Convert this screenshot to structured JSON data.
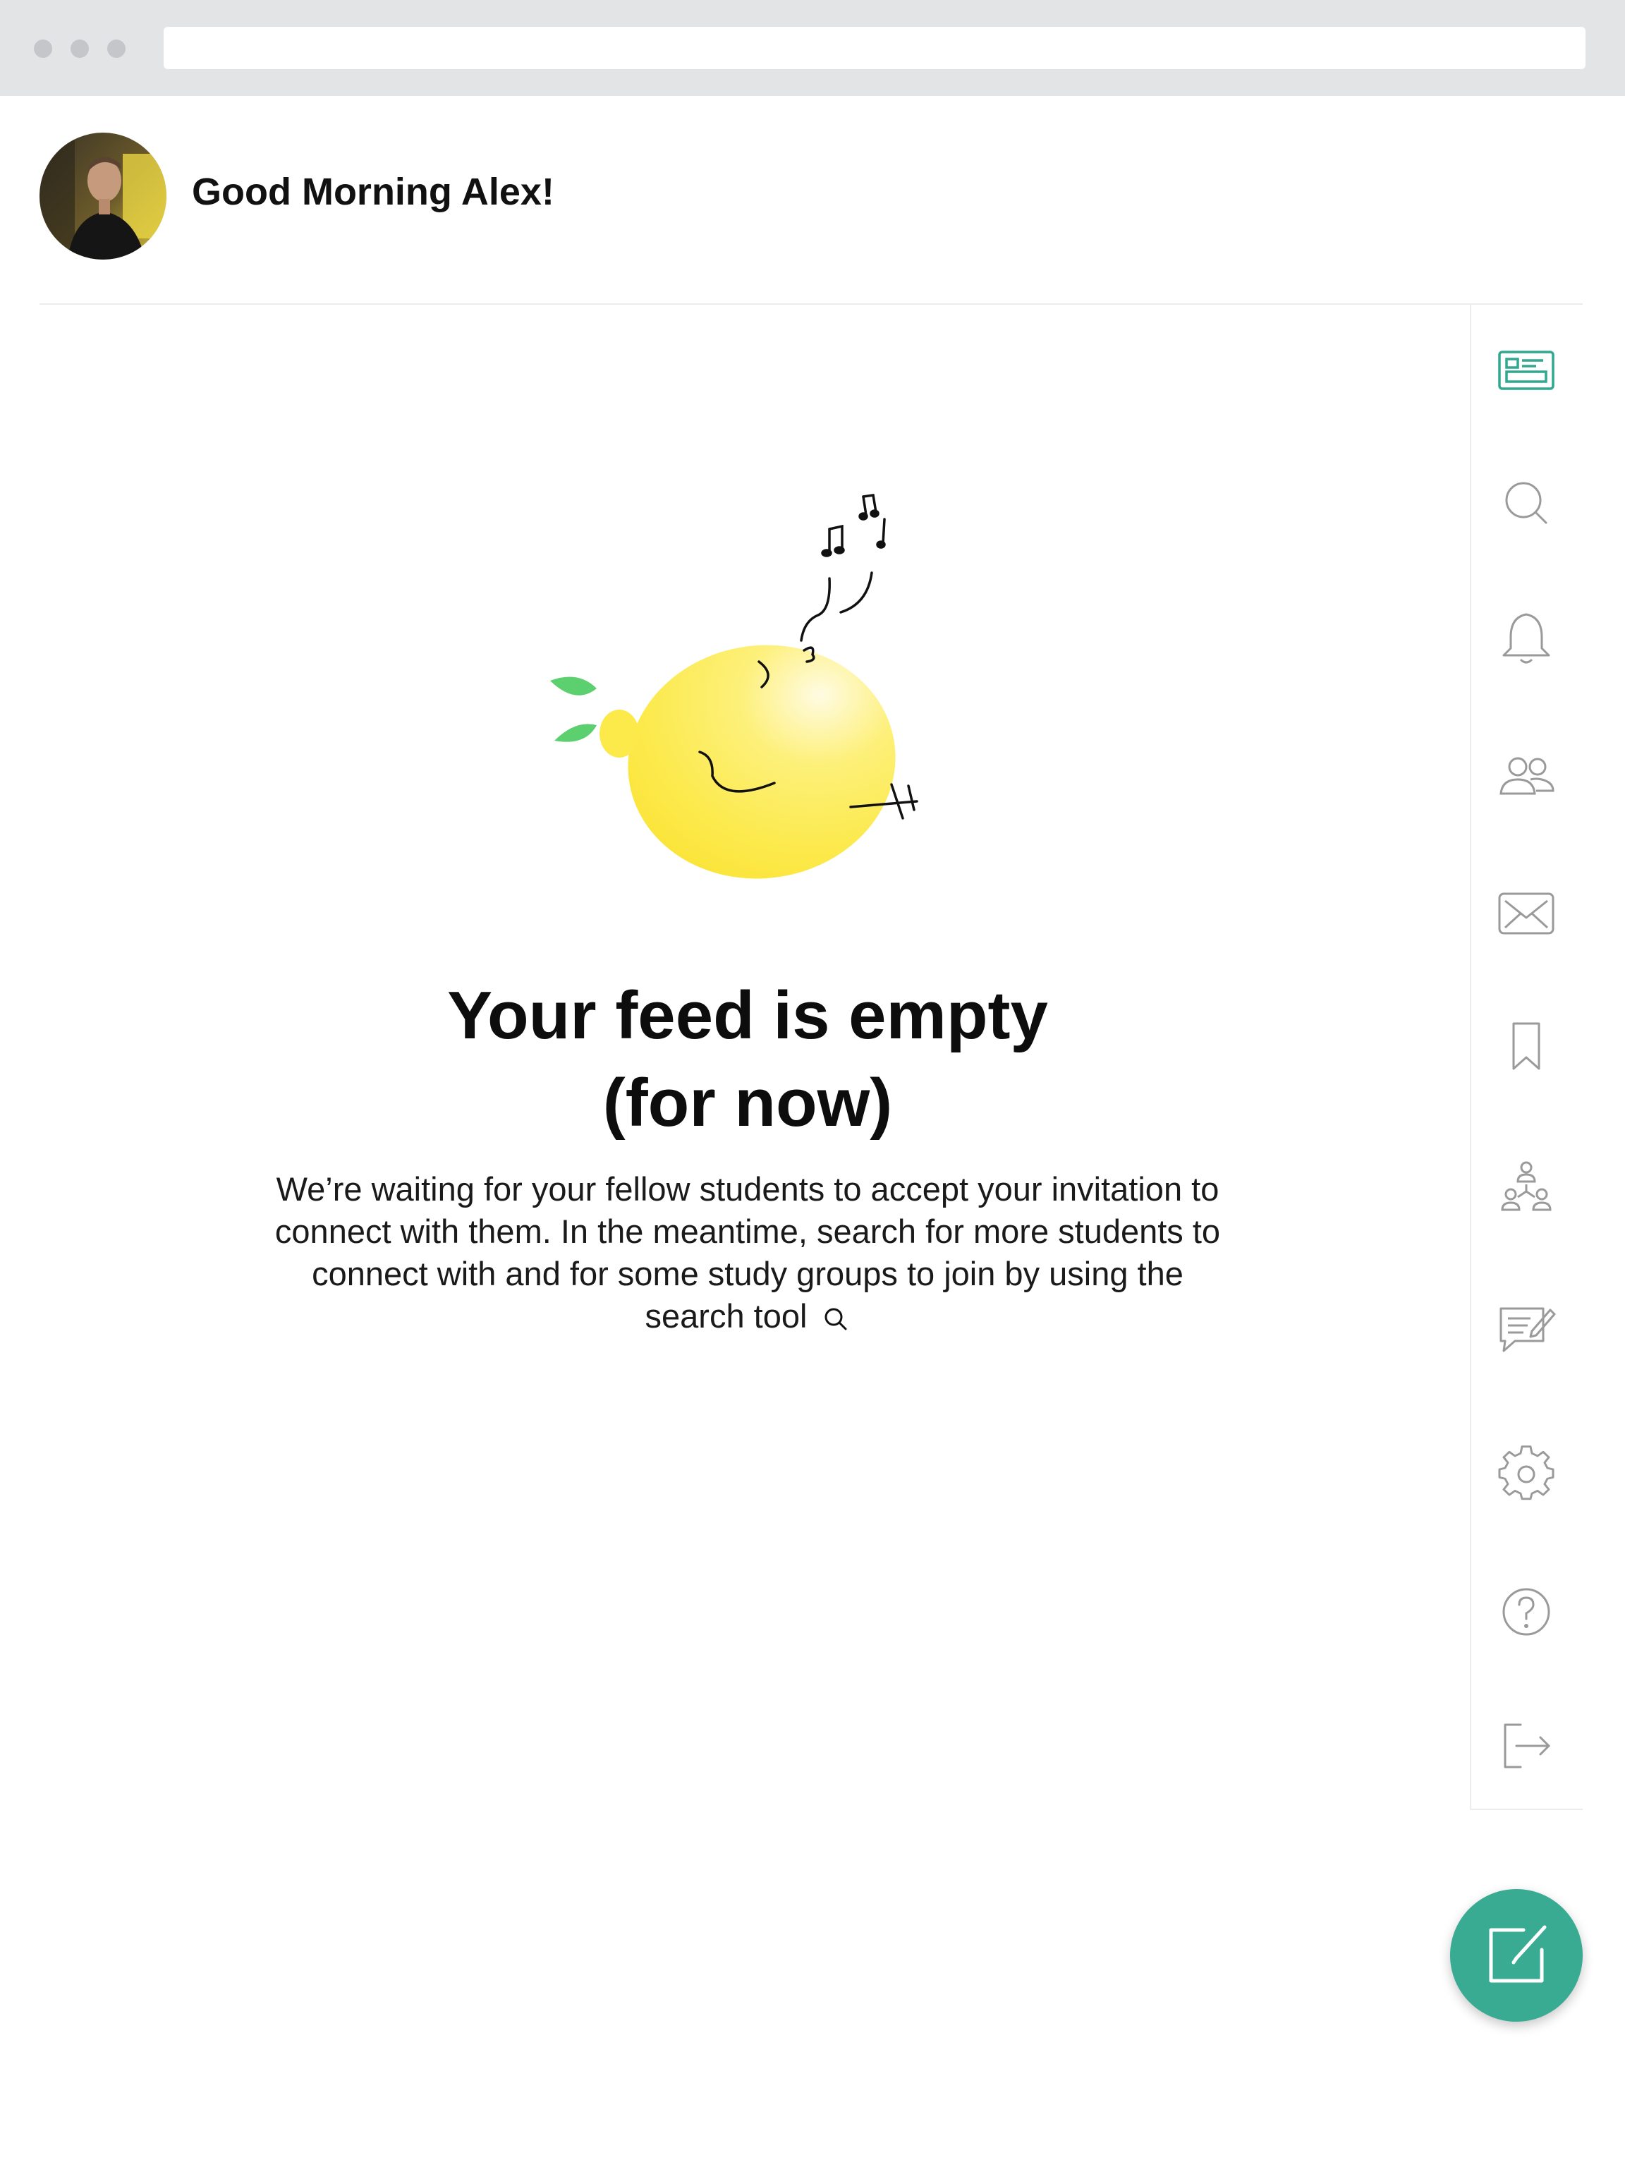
{
  "header": {
    "greeting": "Good Morning Alex!"
  },
  "sidebar": {
    "items": [
      {
        "name": "feed",
        "icon": "feed-icon",
        "active": true
      },
      {
        "name": "search",
        "icon": "search-icon",
        "active": false
      },
      {
        "name": "notifications",
        "icon": "bell-icon",
        "active": false
      },
      {
        "name": "connections",
        "icon": "people-icon",
        "active": false
      },
      {
        "name": "messages",
        "icon": "mail-icon",
        "active": false
      },
      {
        "name": "saved",
        "icon": "bookmark-icon",
        "active": false
      },
      {
        "name": "groups",
        "icon": "groups-icon",
        "active": false
      },
      {
        "name": "posts",
        "icon": "chat-edit-icon",
        "active": false
      },
      {
        "name": "settings",
        "icon": "gear-icon",
        "active": false
      },
      {
        "name": "help",
        "icon": "help-icon",
        "active": false
      },
      {
        "name": "logout",
        "icon": "logout-icon",
        "active": false
      }
    ]
  },
  "main": {
    "empty_title_line1": "Your feed is empty",
    "empty_title_line2": "(for now)",
    "empty_description": "We’re waiting for your fellow students to accept your invitation to connect with them. In the meantime, search for more students to connect with and for some study groups to join by using the search tool"
  },
  "fab": {
    "icon": "compose-icon"
  },
  "colors": {
    "accent": "#2fa88f",
    "icon_gray": "#9a9a9a",
    "fab_bg": "#3aab93",
    "lemon": "#fce94a",
    "leaf": "#5ccf6f"
  }
}
